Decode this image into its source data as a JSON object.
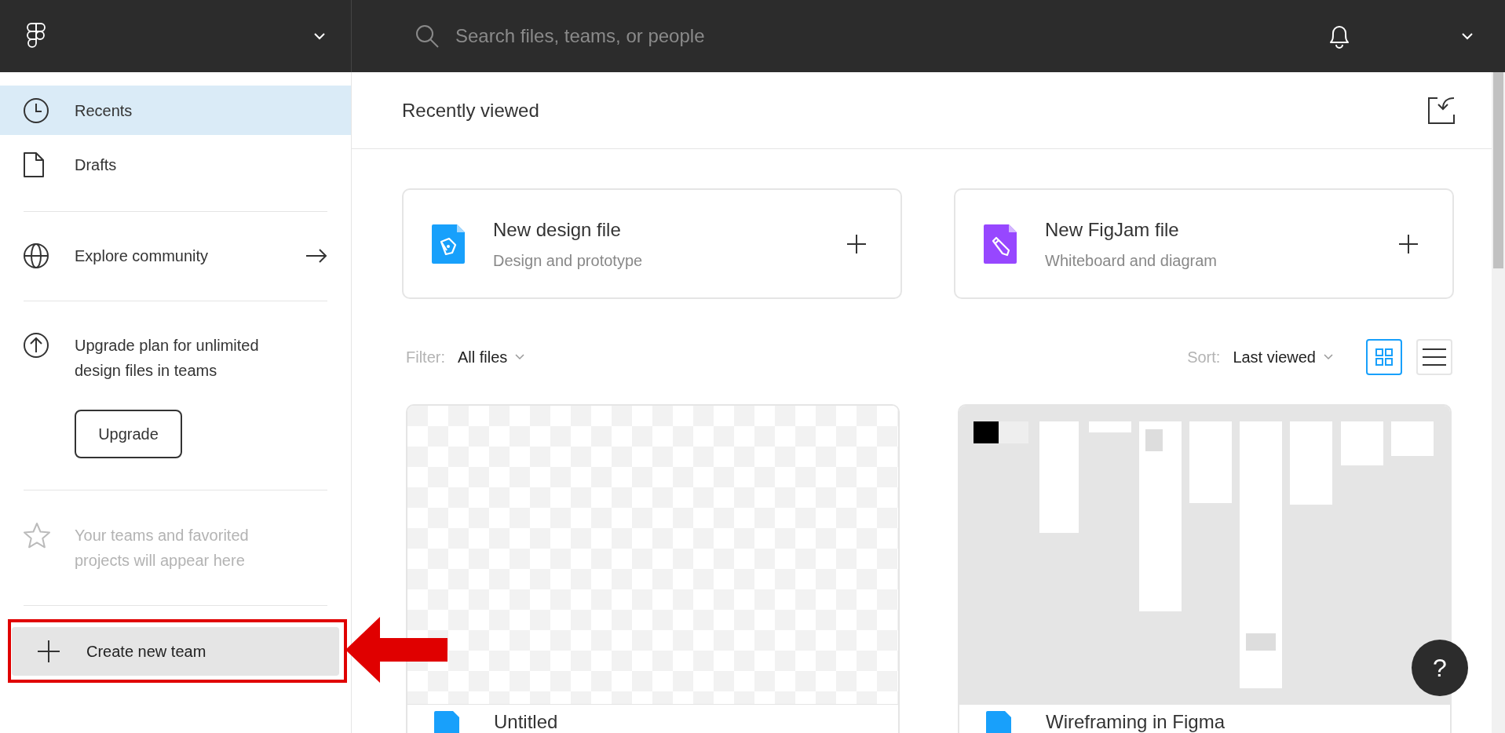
{
  "topbar": {
    "search": {
      "placeholder": "Search files, teams, or people"
    }
  },
  "sidebar": {
    "nav": [
      {
        "kind": "clock",
        "label": "Recents",
        "selected": true
      },
      {
        "kind": "file",
        "label": "Drafts",
        "selected": false
      }
    ],
    "explore": {
      "label": "Explore community"
    },
    "upgrade": {
      "text": "Upgrade plan for unlimited design files in teams",
      "button": "Upgrade"
    },
    "favorites_hint": "Your teams and favorited projects will appear here",
    "create_team": {
      "label": "Create new team"
    }
  },
  "main": {
    "title": "Recently viewed",
    "new_files": [
      {
        "kind": "design",
        "title": "New design file",
        "subtitle": "Design and prototype"
      },
      {
        "kind": "figjam",
        "title": "New FigJam file",
        "subtitle": "Whiteboard and diagram"
      }
    ],
    "filter": {
      "label": "Filter:",
      "value": "All files"
    },
    "sort": {
      "label": "Sort:",
      "value": "Last viewed"
    },
    "view_modes": [
      {
        "kind": "grid",
        "selected": true
      },
      {
        "kind": "list",
        "selected": false
      }
    ],
    "files": [
      {
        "kind": "blank",
        "title": "Untitled"
      },
      {
        "kind": "picture",
        "title": "Wireframing in Figma"
      }
    ]
  },
  "help": {
    "label": "?"
  }
}
